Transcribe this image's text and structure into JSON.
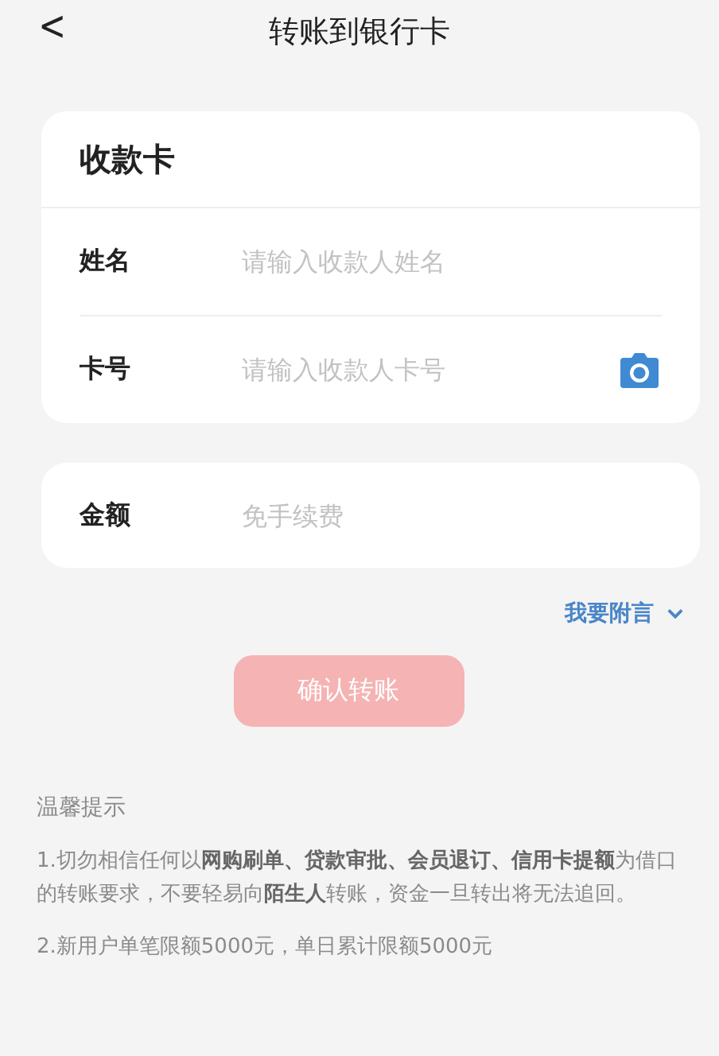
{
  "header": {
    "back_icon": "<",
    "title": "转账到银行卡"
  },
  "payee_card": {
    "title": "收款卡",
    "fields": [
      {
        "label": "姓名",
        "placeholder": "请输入收款人姓名",
        "kind": "text"
      },
      {
        "label": "卡号",
        "placeholder": "请输入收款人卡号",
        "kind": "camera"
      }
    ]
  },
  "amount": {
    "label": "金额",
    "placeholder": "免手续费"
  },
  "note_link": {
    "label": "我要附言",
    "expanded": false
  },
  "confirm_button": {
    "label": "确认转账",
    "disabled": true
  },
  "tips": {
    "title": "温馨提示",
    "items": [
      "1.切勿相信任何以**网购刷单、贷款审批、会员退订、信用卡提额**为借口的转账要求，不要轻易向**陌生人**转账，资金一旦转出将无法追回。",
      "2.新用户单笔限额5000元，单日累计限额5000元"
    ]
  }
}
